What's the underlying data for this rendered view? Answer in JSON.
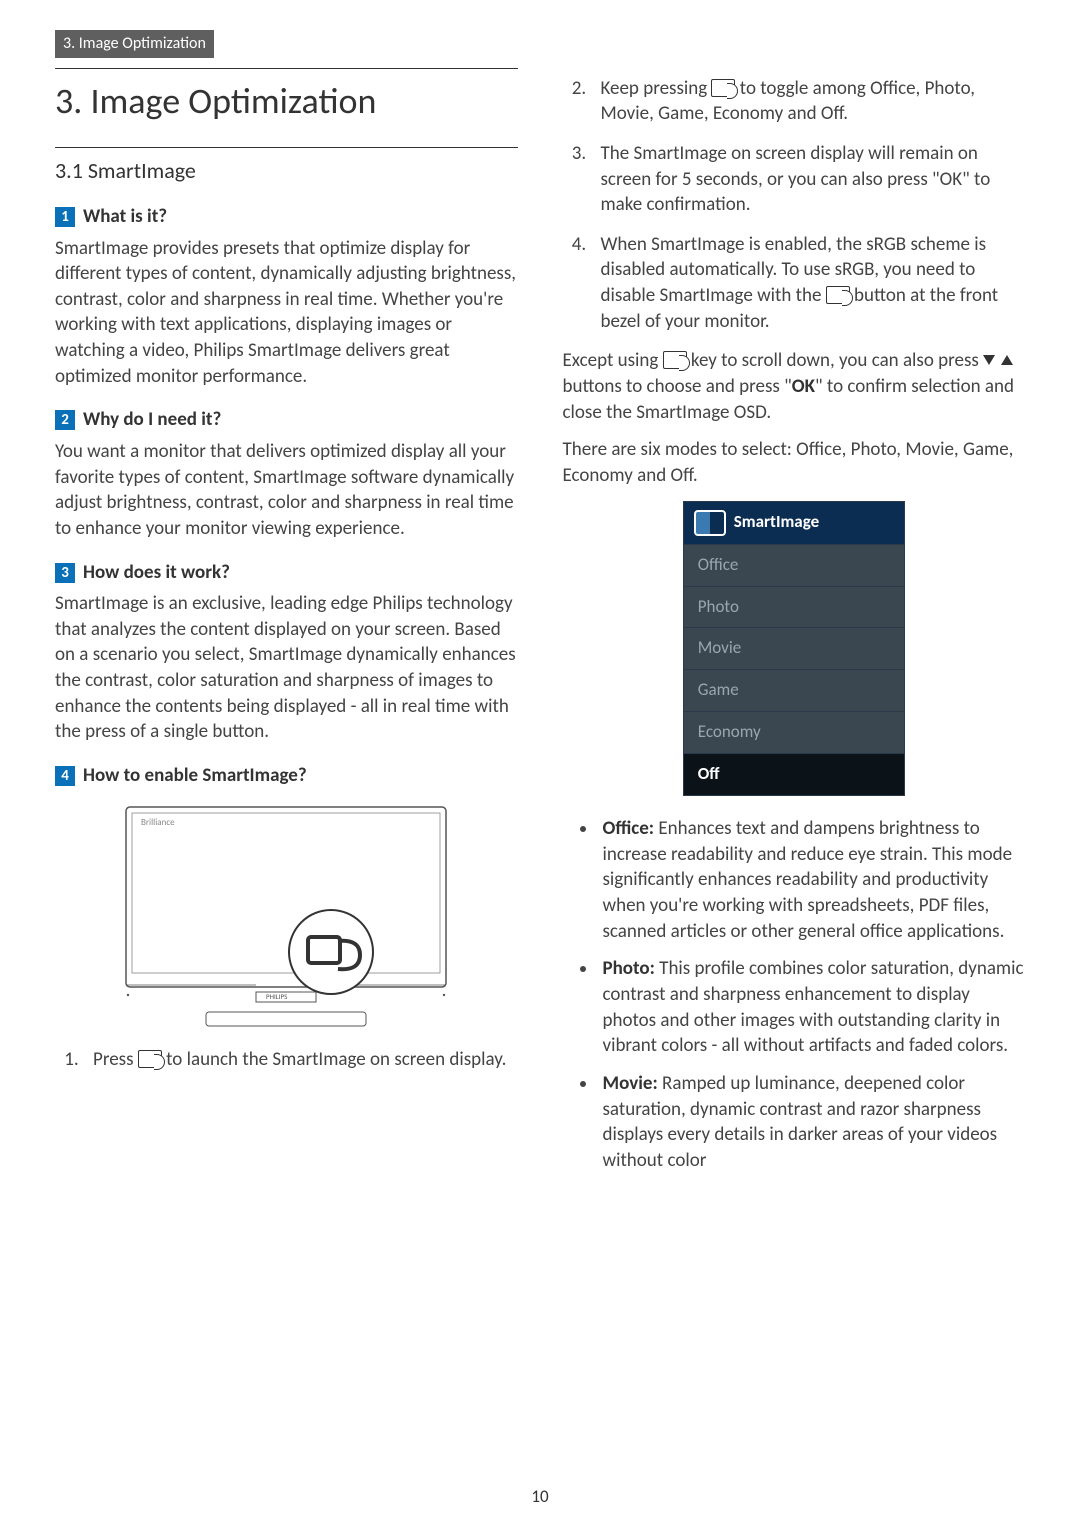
{
  "header": "3. Image Optimization",
  "chapter_title": "3.  Image Optimization",
  "section_title": "3.1  SmartImage",
  "left": {
    "q1": {
      "num": "1",
      "title": "What is it?",
      "body": "SmartImage provides presets that optimize display for different types of content, dynamically adjusting brightness, contrast, color and sharpness in real time. Whether you're working with text applications, displaying images or watching a video, Philips SmartImage delivers great optimized monitor performance."
    },
    "q2": {
      "num": "2",
      "title": "Why do I need it?",
      "body": "You want a monitor that delivers optimized display all your favorite types of content, SmartImage software dynamically adjust brightness, contrast, color and sharpness in real time to enhance your monitor viewing experience."
    },
    "q3": {
      "num": "3",
      "title": "How does it work?",
      "body": "SmartImage is an exclusive, leading edge Philips technology that analyzes the content displayed on your screen. Based on a scenario you select, SmartImage dynamically enhances the contrast, color saturation and sharpness of images to enhance the contents being displayed - all in real time with the press of a single button."
    },
    "q4": {
      "num": "4",
      "title": "How to enable SmartImage?"
    },
    "step1_a": "Press ",
    "step1_b": " to launch the SmartImage on screen display."
  },
  "right": {
    "step2_a": "Keep pressing ",
    "step2_b": " to toggle among Office, Photo, Movie, Game, Economy and Off.",
    "step3": "The SmartImage on screen display will remain on screen for 5 seconds, or you can also press \"OK\" to make confirmation.",
    "step4_a": "When SmartImage is enabled, the sRGB scheme is disabled automatically. To use sRGB, you need to disable SmartImage with the ",
    "step4_b": " button at the front bezel of your monitor.",
    "except_a": "Except using ",
    "except_b": " key to scroll down, you can also press ",
    "except_c": " buttons to choose and press \"",
    "except_ok": "OK",
    "except_d": "\" to confirm selection and close the SmartImage OSD.",
    "modes_intro": "There are six modes to select: Office, Photo, Movie, Game, Economy and Off.",
    "osd_title": "SmartImage",
    "osd_items": [
      "Office",
      "Photo",
      "Movie",
      "Game",
      "Economy",
      "Off"
    ],
    "bullets": {
      "office": {
        "label": "Office:",
        "body": " Enhances text and dampens brightness to increase readability and reduce eye strain. This mode significantly enhances readability and productivity when you're working with spreadsheets, PDF files, scanned articles or other general office applications."
      },
      "photo": {
        "label": "Photo:",
        "body": " This profile combines color saturation, dynamic contrast and sharpness enhancement to display photos and other images with outstanding clarity in vibrant colors - all without artifacts and faded colors."
      },
      "movie": {
        "label": "Movie:",
        "body": " Ramped up luminance, deepened color saturation, dynamic contrast and razor sharpness displays every details in darker areas of your videos without color"
      }
    }
  },
  "page_number": "10"
}
